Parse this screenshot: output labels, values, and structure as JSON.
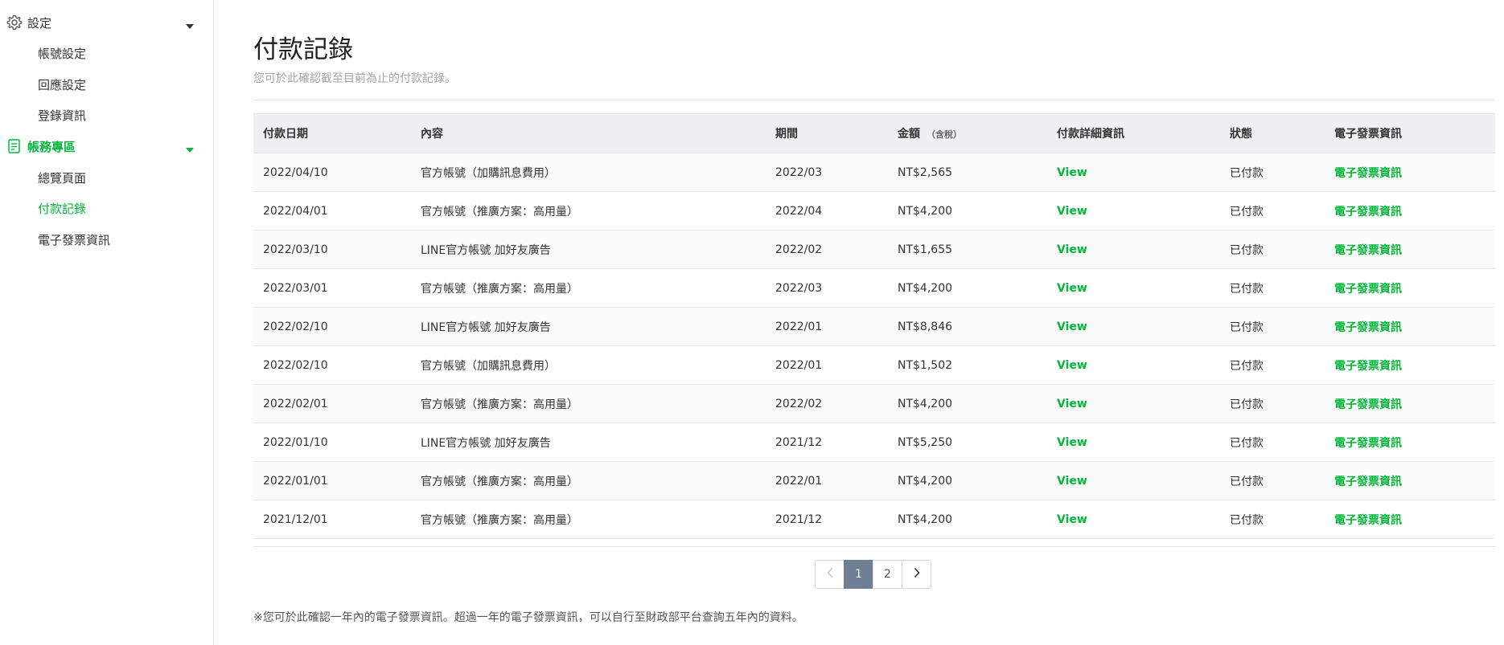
{
  "sidebar": {
    "settings": {
      "label": "設定",
      "items": [
        "帳號設定",
        "回應設定",
        "登錄資訊"
      ]
    },
    "billing": {
      "label": "帳務專區",
      "items": [
        "總覽頁面",
        "付款記錄",
        "電子發票資訊"
      ],
      "active_item": "付款記錄"
    }
  },
  "page": {
    "title": "付款記錄",
    "subtitle": "您可於此確認截至目前為止的付款記錄。"
  },
  "table": {
    "headers": {
      "date": "付款日期",
      "content": "內容",
      "period": "期間",
      "amount": "金額",
      "amount_note": "（含稅）",
      "details": "付款詳細資訊",
      "status": "狀態",
      "invoice": "電子發票資訊"
    },
    "rows": [
      {
        "date": "2022/04/10",
        "content": "官方帳號（加購訊息費用）",
        "period": "2022/03",
        "amount": "NT$2,565",
        "details": "View",
        "status": "已付款",
        "invoice": "電子發票資訊"
      },
      {
        "date": "2022/04/01",
        "content": "官方帳號（推廣方案：高用量）",
        "period": "2022/04",
        "amount": "NT$4,200",
        "details": "View",
        "status": "已付款",
        "invoice": "電子發票資訊"
      },
      {
        "date": "2022/03/10",
        "content": "LINE官方帳號 加好友廣告",
        "period": "2022/02",
        "amount": "NT$1,655",
        "details": "View",
        "status": "已付款",
        "invoice": "電子發票資訊"
      },
      {
        "date": "2022/03/01",
        "content": "官方帳號（推廣方案：高用量）",
        "period": "2022/03",
        "amount": "NT$4,200",
        "details": "View",
        "status": "已付款",
        "invoice": "電子發票資訊"
      },
      {
        "date": "2022/02/10",
        "content": "LINE官方帳號 加好友廣告",
        "period": "2022/01",
        "amount": "NT$8,846",
        "details": "View",
        "status": "已付款",
        "invoice": "電子發票資訊"
      },
      {
        "date": "2022/02/10",
        "content": "官方帳號（加購訊息費用）",
        "period": "2022/01",
        "amount": "NT$1,502",
        "details": "View",
        "status": "已付款",
        "invoice": "電子發票資訊"
      },
      {
        "date": "2022/02/01",
        "content": "官方帳號（推廣方案：高用量）",
        "period": "2022/02",
        "amount": "NT$4,200",
        "details": "View",
        "status": "已付款",
        "invoice": "電子發票資訊"
      },
      {
        "date": "2022/01/10",
        "content": "LINE官方帳號 加好友廣告",
        "period": "2021/12",
        "amount": "NT$5,250",
        "details": "View",
        "status": "已付款",
        "invoice": "電子發票資訊"
      },
      {
        "date": "2022/01/01",
        "content": "官方帳號（推廣方案：高用量）",
        "period": "2022/01",
        "amount": "NT$4,200",
        "details": "View",
        "status": "已付款",
        "invoice": "電子發票資訊"
      },
      {
        "date": "2021/12/01",
        "content": "官方帳號（推廣方案：高用量）",
        "period": "2021/12",
        "amount": "NT$4,200",
        "details": "View",
        "status": "已付款",
        "invoice": "電子發票資訊"
      }
    ]
  },
  "pagination": {
    "pages": [
      "1",
      "2"
    ],
    "current": "1",
    "prev_icon": "chevron-left-icon",
    "next_icon": "chevron-right-icon"
  },
  "footnote": "※您可於此確認一年內的電子發票資訊。超過一年的電子發票資訊，可以自行至財政部平台查詢五年內的資料。",
  "colors": {
    "accent": "#06b53c",
    "current_page": "#6e7f93",
    "header_bg": "#eef0f2"
  }
}
